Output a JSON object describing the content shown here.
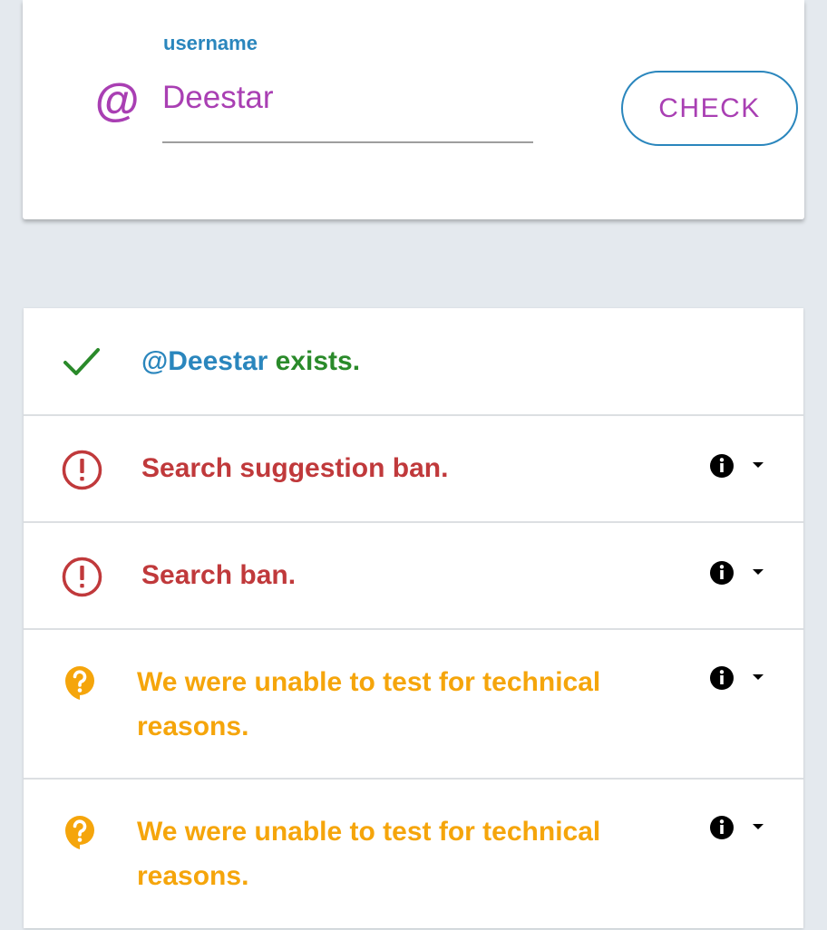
{
  "form": {
    "label": "username",
    "value": "Deestar",
    "at_symbol": "@",
    "check_label": "CHECK"
  },
  "results": {
    "exists": {
      "handle": "@Deestar",
      "text": " exists.",
      "icon": "check-icon"
    },
    "items": [
      {
        "text": "Search suggestion ban.",
        "status": "banned",
        "icon": "alert-circle-icon"
      },
      {
        "text": "Search ban.",
        "status": "banned",
        "icon": "alert-circle-icon"
      },
      {
        "text": "We were unable to test for technical reasons.",
        "status": "unknown",
        "icon": "question-bubble-icon"
      },
      {
        "text": "We were unable to test for technical reasons.",
        "status": "unknown",
        "icon": "question-bubble-icon"
      }
    ]
  },
  "colors": {
    "accent_blue": "#2a86bd",
    "accent_purple": "#a93fb3",
    "ok_green": "#2a8a2a",
    "ban_red": "#c0393b",
    "warn_orange": "#f5a50b",
    "background": "#e4e9ee"
  }
}
